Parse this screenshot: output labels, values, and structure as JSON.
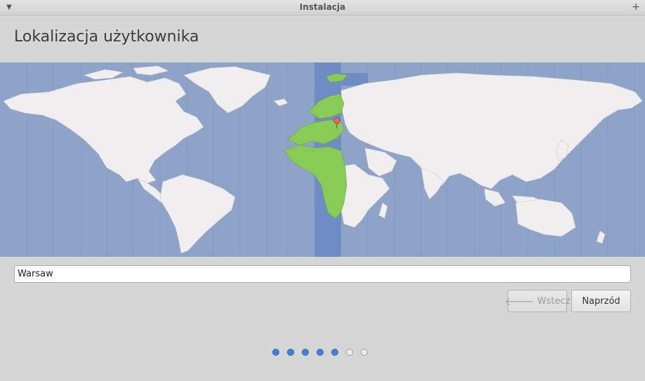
{
  "window": {
    "title": "Instalacja",
    "menu_icon": "triangle-down-icon",
    "maximize_icon": "plus-icon"
  },
  "page": {
    "title": "Lokalizacja użytkownika"
  },
  "map": {
    "selected_timezone": "Europe/Warsaw",
    "colors": {
      "ocean": "#8da3c8",
      "land": "#f0eeee",
      "highlight_band": "#6f8dc4",
      "highlight_land": "#88cc55",
      "marker": "#f06a6a"
    }
  },
  "location": {
    "value": "Warsaw"
  },
  "buttons": {
    "back_label": "Wstecz",
    "next_label": "Naprzód"
  },
  "progress": {
    "total_steps": 7,
    "completed_steps": 5
  }
}
